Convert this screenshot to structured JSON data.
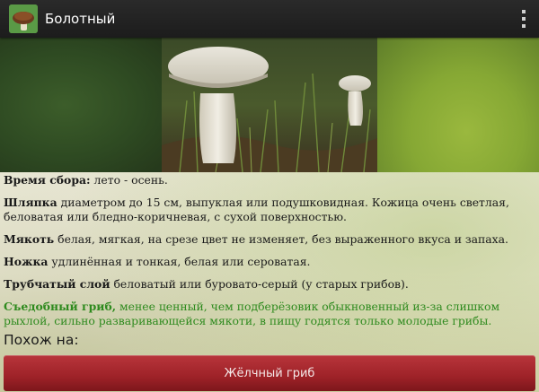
{
  "app": {
    "title": "Болотный"
  },
  "sections": {
    "harvest": {
      "label": "Время сбора:",
      "text": " лето - осень."
    },
    "cap": {
      "label": "Шляпка",
      "text": " диаметром до 15 см, выпуклая или подушковидная. Кожица очень светлая, беловатая или бледно-коричневая, с сухой поверхностью."
    },
    "flesh": {
      "label": "Мякоть",
      "text": " белая, мягкая, на срезе цвет не изменяет, без выраженного вкуса и запаха."
    },
    "stem": {
      "label": "Ножка",
      "text": " удлинённая и тонкая, белая или сероватая."
    },
    "tubes": {
      "label": "Трубчатый слой",
      "text": " беловатый или буровато-серый (у старых грибов)."
    },
    "edibility": {
      "label": "Съедобный гриб,",
      "text": " менее ценный, чем подберёзовик обыкновенный из-за слишком рыхлой, сильно разваривающейся мякоти, в пищу годятся только молодые грибы."
    }
  },
  "similar": {
    "label": "Похож на:",
    "button": "Жёлчный гриб"
  },
  "colors": {
    "actionbar": "#1c1c1c",
    "edible_text": "#2e8a1e",
    "button": "#9e2228"
  }
}
